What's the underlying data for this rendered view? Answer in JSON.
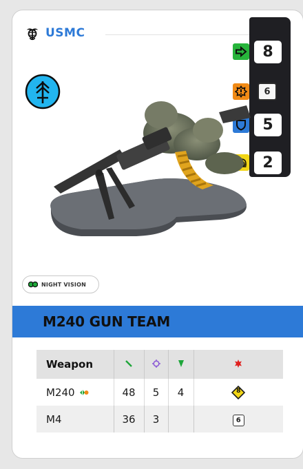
{
  "faction": {
    "name": "USMC",
    "emblem": "eagle-globe-anchor-icon"
  },
  "unit_type_icon": "antenna-infantry-icon",
  "stats": [
    {
      "icon": "move-arrow-icon",
      "color": "#27b43b",
      "value": "8"
    },
    {
      "icon": "alert-burst-icon",
      "color": "#f08a16",
      "die": "6"
    },
    {
      "icon": "shield-icon",
      "color": "#2d7ad7",
      "value": "5"
    },
    {
      "icon": "helmet-icon",
      "color": "#f2d616",
      "value": "2"
    }
  ],
  "model_image": "m240-gun-team-miniature",
  "keywords": [
    {
      "label": "NIGHT VISION",
      "icon": "night-vision-goggles-icon",
      "color": "#1fa83a"
    }
  ],
  "unit": {
    "title": "M240 GUN TEAM"
  },
  "weapons": {
    "headers": {
      "name": "Weapon",
      "range_icon": "range-line-icon",
      "dice_icon": "target-crosshair-icon",
      "ap_icon": "armor-pierce-icon",
      "special_icon": "burst-star-icon"
    },
    "rows": [
      {
        "name": "M240",
        "trait_icon": "suppression-icon",
        "range": "48",
        "dice": "5",
        "ap": "4",
        "special": "8",
        "special_type": "diamond"
      },
      {
        "name": "M4",
        "range": "36",
        "dice": "3",
        "ap": "",
        "special": "6",
        "special_type": "die"
      }
    ]
  },
  "colors": {
    "accent": "#2d7ad7",
    "stat_panel": "#1f1f23",
    "move": "#27b43b",
    "alert": "#f08a16",
    "defense": "#2d7ad7",
    "morale": "#f2d616"
  }
}
